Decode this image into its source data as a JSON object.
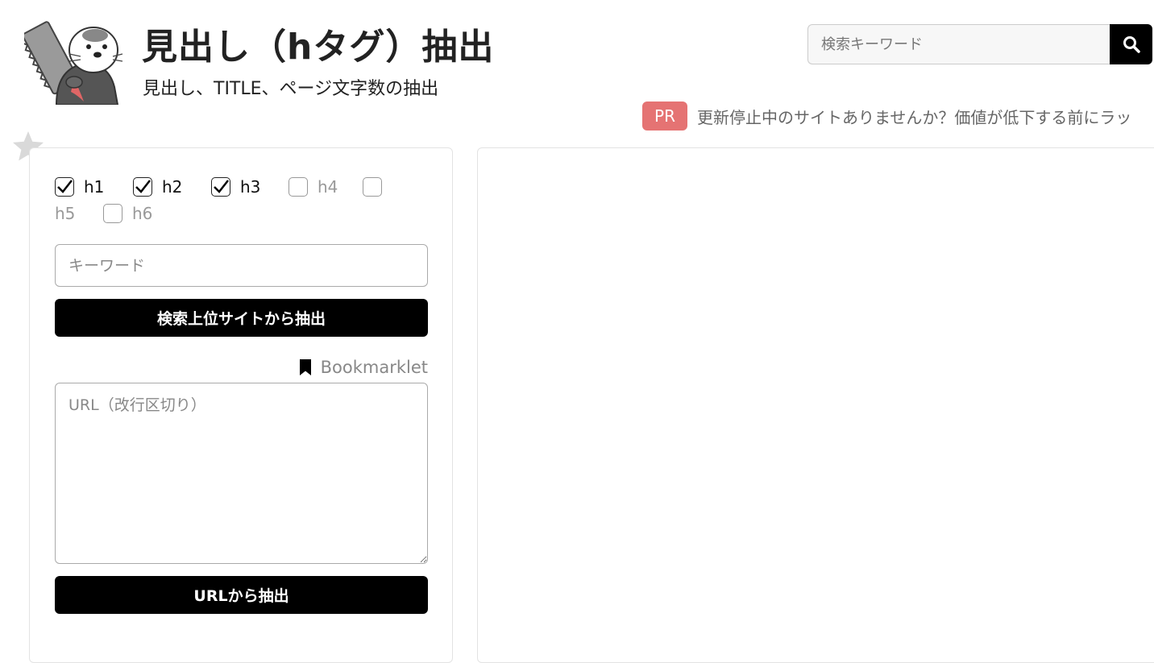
{
  "header": {
    "title": "見出し（hタグ）抽出",
    "subtitle": "見出し、TITLE、ページ文字数の抽出"
  },
  "search": {
    "placeholder": "検索キーワード",
    "button_icon": "search-icon"
  },
  "pr": {
    "badge": "PR",
    "text": "更新停止中のサイトありませんか？価値が低下する前にラッ"
  },
  "form": {
    "checkboxes": [
      {
        "label": "h1",
        "checked": true
      },
      {
        "label": "h2",
        "checked": true
      },
      {
        "label": "h3",
        "checked": true
      },
      {
        "label": "h4",
        "checked": false
      },
      {
        "label": "h5",
        "checked": false
      },
      {
        "label": "h6",
        "checked": false
      }
    ],
    "keyword_placeholder": "キーワード",
    "search_extract_button": "検索上位サイトから抽出",
    "bookmarklet_label": "Bookmarklet",
    "url_placeholder": "URL（改行区切り）",
    "url_extract_button": "URLから抽出"
  },
  "colors": {
    "accent": "#000000",
    "pr_badge": "#e57373"
  }
}
